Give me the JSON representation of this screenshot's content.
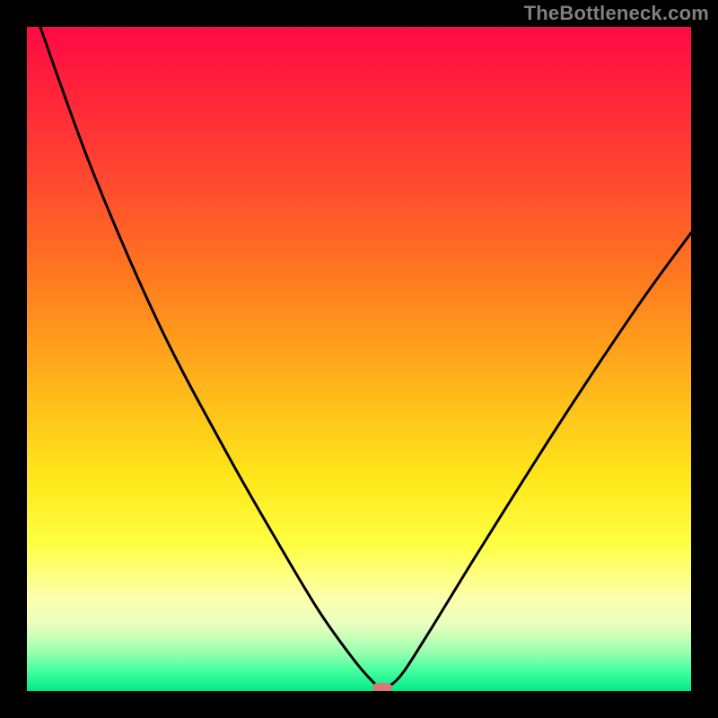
{
  "watermark": "TheBottleneck.com",
  "chart_data": {
    "type": "line",
    "title": "",
    "xlabel": "",
    "ylabel": "",
    "xlim": [
      0,
      100
    ],
    "ylim": [
      0,
      100
    ],
    "grid": false,
    "legend": false,
    "series": [
      {
        "name": "curve",
        "x": [
          2,
          10,
          20,
          30,
          38,
          44,
          49,
          52,
          53.5,
          56,
          60,
          68,
          80,
          92,
          100
        ],
        "values": [
          100,
          78,
          55,
          36,
          22,
          12,
          5,
          1.5,
          0.5,
          2,
          8,
          21,
          40,
          58,
          69
        ]
      }
    ],
    "marker": {
      "x": 53.5,
      "y": 0.5,
      "color": "#d77a76"
    },
    "background_gradient": {
      "stops": [
        {
          "pct": 0,
          "color": "#ff0a46"
        },
        {
          "pct": 40,
          "color": "#ff8a1d"
        },
        {
          "pct": 70,
          "color": "#ffe71a"
        },
        {
          "pct": 88,
          "color": "#fdffae"
        },
        {
          "pct": 100,
          "color": "#00e989"
        }
      ]
    }
  }
}
